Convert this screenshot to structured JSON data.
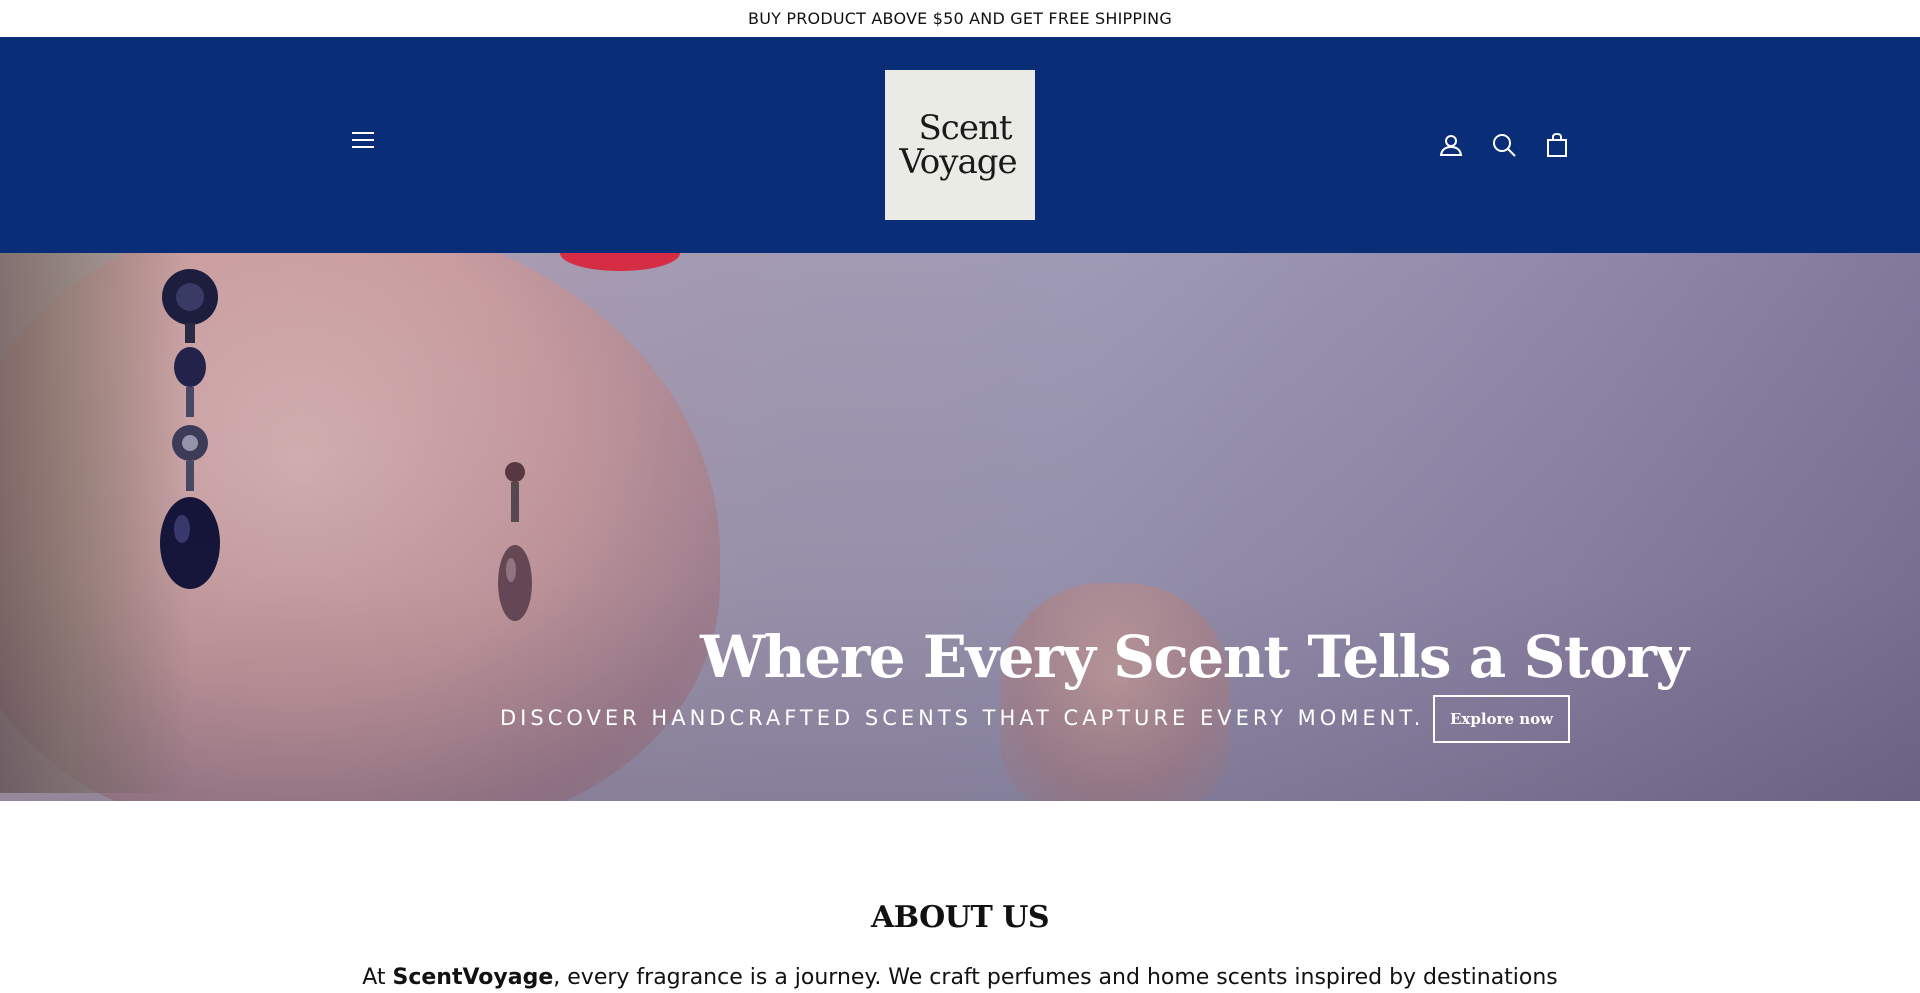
{
  "announcement": "BUY PRODUCT ABOVE $50 AND GET FREE SHIPPING",
  "header": {
    "background": "#0a2d77",
    "logo": {
      "line1": "Scent",
      "line2": "Voyage"
    },
    "icons": [
      "menu-icon",
      "account-icon",
      "search-icon",
      "cart-icon"
    ]
  },
  "hero": {
    "title": "Where Every Scent Tells a Story",
    "subtitle": "DISCOVER HANDCRAFTED SCENTS THAT CAPTURE EVERY MOMENT.",
    "button_label": "Explore now"
  },
  "about": {
    "title": "ABOUT US",
    "text_prefix": "At ",
    "brand": "ScentVoyage",
    "text_suffix": ", every fragrance is a journey. We craft perfumes and home scents inspired by destinations"
  }
}
